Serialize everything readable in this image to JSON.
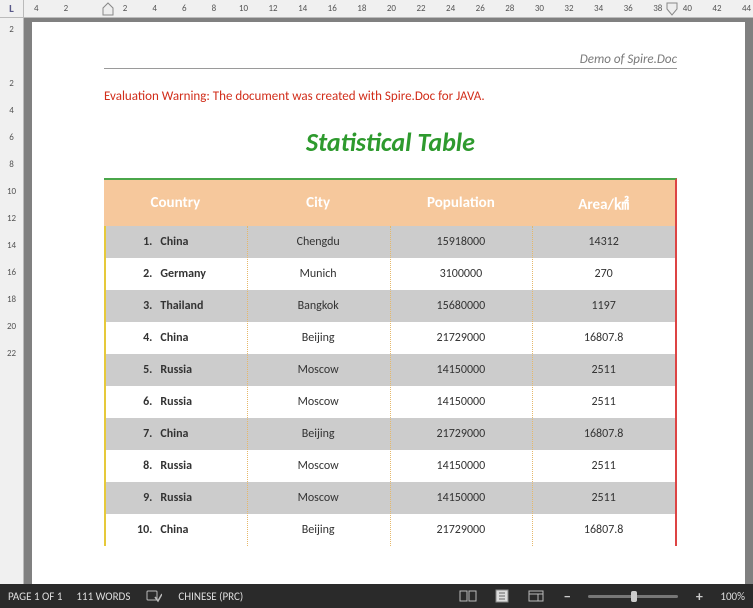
{
  "ruler_h": [
    "4",
    "2",
    "",
    "2",
    "4",
    "6",
    "8",
    "10",
    "12",
    "14",
    "16",
    "18",
    "20",
    "22",
    "24",
    "26",
    "28",
    "30",
    "32",
    "34",
    "36",
    "38",
    "40",
    "42",
    "44"
  ],
  "ruler_v": [
    "2",
    "",
    "2",
    "4",
    "6",
    "8",
    "10",
    "12",
    "14",
    "16",
    "18",
    "20",
    "22"
  ],
  "ruler_corner": "L",
  "doc": {
    "demo_header": "Demo of Spire.Doc",
    "eval_warning": "Evaluation Warning: The document was created with Spire.Doc for JAVA.",
    "title": "Statistical Table",
    "headers": {
      "country": "Country",
      "city": "City",
      "population": "Population",
      "area": "Area/㎢"
    },
    "rows": [
      {
        "n": "1.",
        "country": "China",
        "city": "Chengdu",
        "population": "15918000",
        "area": "14312"
      },
      {
        "n": "2.",
        "country": "Germany",
        "city": "Munich",
        "population": "3100000",
        "area": "270"
      },
      {
        "n": "3.",
        "country": "Thailand",
        "city": "Bangkok",
        "population": "15680000",
        "area": "1197"
      },
      {
        "n": "4.",
        "country": "China",
        "city": "Beijing",
        "population": "21729000",
        "area": "16807.8"
      },
      {
        "n": "5.",
        "country": "Russia",
        "city": "Moscow",
        "population": "14150000",
        "area": "2511"
      },
      {
        "n": "6.",
        "country": "Russia",
        "city": "Moscow",
        "population": "14150000",
        "area": "2511"
      },
      {
        "n": "7.",
        "country": "China",
        "city": "Beijing",
        "population": "21729000",
        "area": "16807.8"
      },
      {
        "n": "8.",
        "country": "Russia",
        "city": "Moscow",
        "population": "14150000",
        "area": "2511"
      },
      {
        "n": "9.",
        "country": "Russia",
        "city": "Moscow",
        "population": "14150000",
        "area": "2511"
      },
      {
        "n": "10.",
        "country": "China",
        "city": "Beijing",
        "population": "21729000",
        "area": "16807.8"
      }
    ]
  },
  "status": {
    "page": "PAGE 1 OF 1",
    "words": "111 WORDS",
    "language": "CHINESE (PRC)",
    "zoom": "100%"
  }
}
